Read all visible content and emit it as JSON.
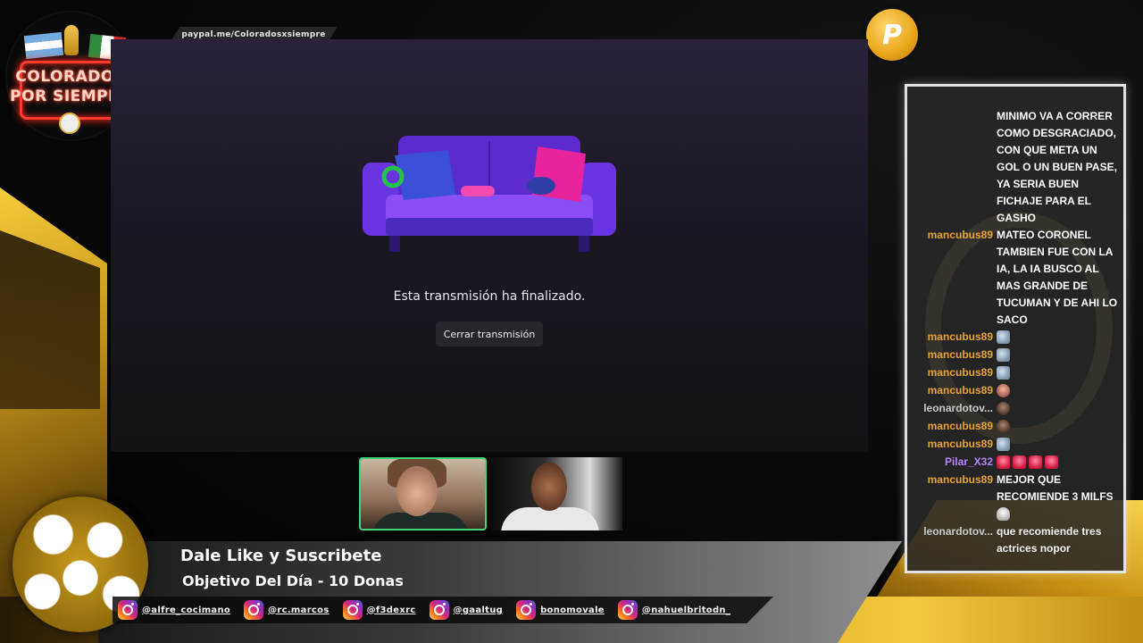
{
  "overlay": {
    "paypal_url": "paypal.me/Coloradosxsiempre",
    "paypal_badge_letter": "P",
    "logo": {
      "line1": "COLORADOS",
      "line2": "POR SIEMPRE"
    }
  },
  "stream": {
    "status_message": "Esta transmisión ha finalizado.",
    "close_button_label": "Cerrar transmisión"
  },
  "lower_third": {
    "title": "Dale Like y Suscribete",
    "subtitle": "Objetivo Del Día - 10 Donas",
    "socials": [
      {
        "handle": "@alfre_cocimano",
        "icon": "instagram-icon"
      },
      {
        "handle": "@rc.marcos",
        "icon": "instagram-icon"
      },
      {
        "handle": "@f3dexrc",
        "icon": "instagram-icon"
      },
      {
        "handle": "@gaaltug",
        "icon": "instagram-icon"
      },
      {
        "handle": "bonomovale",
        "icon": "instagram-icon"
      },
      {
        "handle": "@nahuelbritodn_",
        "icon": "instagram-icon"
      }
    ]
  },
  "chat": {
    "messages": [
      {
        "user": "",
        "text": "MINIMO VA A CORRER COMO DESGRACIADO, CON QUE META UN GOL O UN BUEN PASE, YA SERIA BUEN FICHAJE PARA EL GASHO"
      },
      {
        "user": "mancubus89",
        "text": "MATEO CORONEL TAMBIEN FUE CON LA IA, LA IA BUSCO AL MAS GRANDE DE TUCUMAN Y DE AHI LO SACO"
      },
      {
        "user": "mancubus89",
        "emote": "bird-emote"
      },
      {
        "user": "mancubus89",
        "emote": "bird-emote"
      },
      {
        "user": "mancubus89",
        "emote": "bird-emote"
      },
      {
        "user": "mancubus89",
        "emote": "face-emote"
      },
      {
        "user": "leonardotov...",
        "emote": "face-emote"
      },
      {
        "user": "mancubus89",
        "emote": "face-emote"
      },
      {
        "user": "mancubus89",
        "emote": "bird-emote"
      },
      {
        "user": "Pilar_X32",
        "emote": "siren-emote"
      },
      {
        "user": "mancubus89",
        "text": "MEJOR QUE RECOMIENDE 3 MILFS"
      },
      {
        "user": "leonardotov...",
        "text": "que recomiende tres actrices nopor"
      }
    ]
  },
  "colors": {
    "chat_username": "#e3a431",
    "chat_username_alt": "#b784ff",
    "cam_active_border": "#3fd37a",
    "gold": "#d6a51f"
  }
}
